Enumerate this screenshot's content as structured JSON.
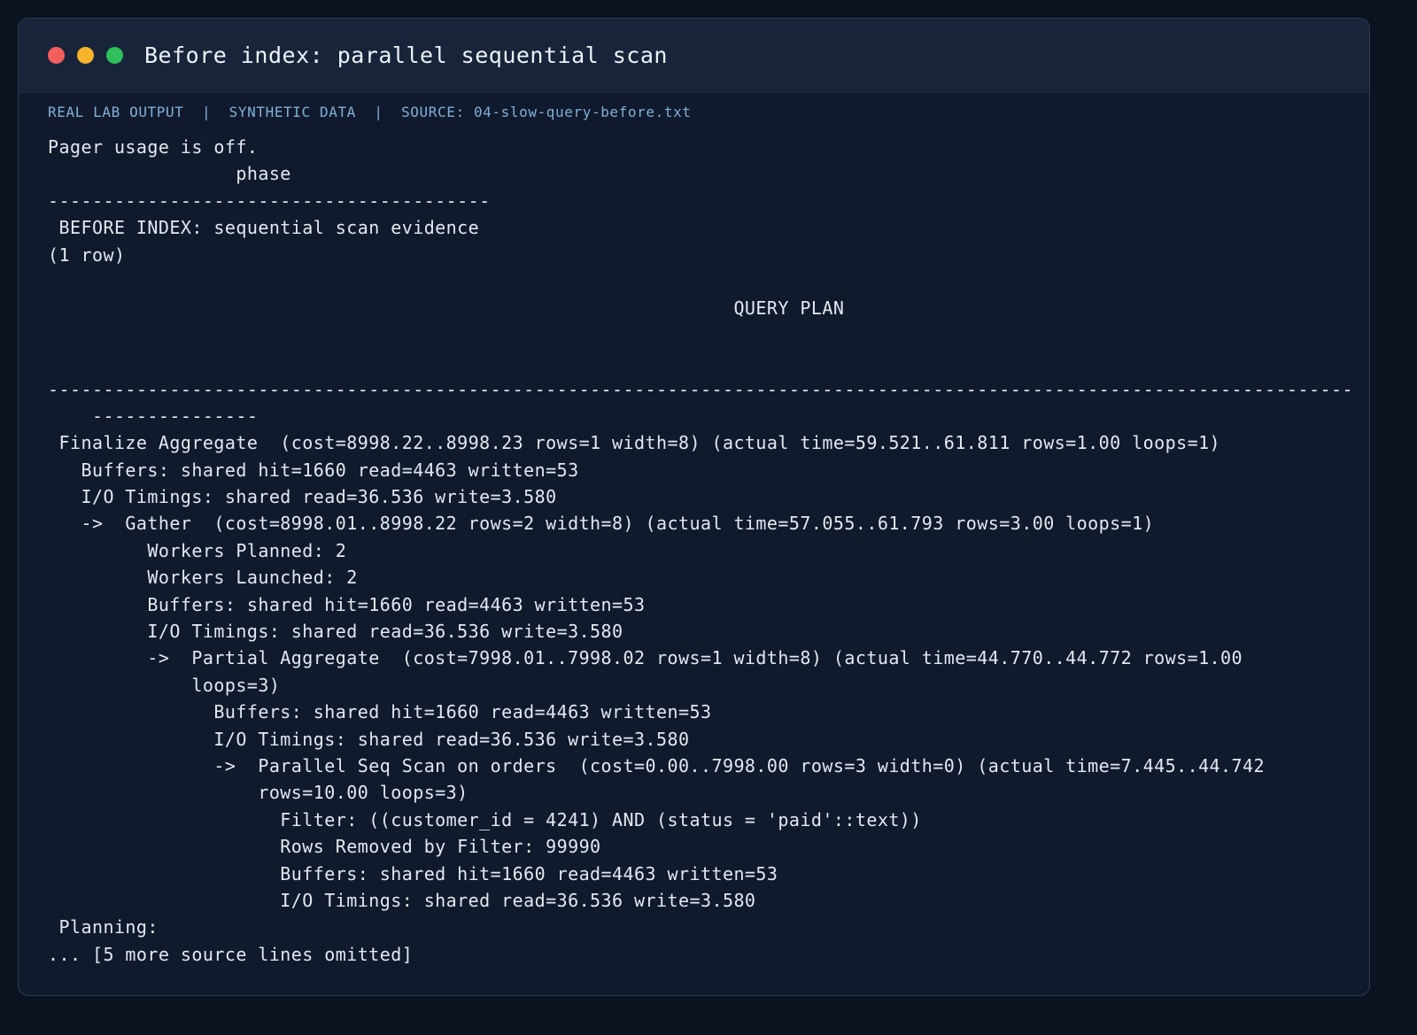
{
  "window": {
    "title": "Before index: parallel sequential scan",
    "buttons": {
      "close_color": "#f25f5c",
      "minimize_color": "#f7b32b",
      "maximize_color": "#2fbf5b"
    }
  },
  "meta": {
    "text": "REAL LAB OUTPUT  |  SYNTHETIC DATA  |  SOURCE: 04-slow-query-before.txt"
  },
  "output": {
    "lines": [
      "Pager usage is off.",
      "                 phase",
      "----------------------------------------",
      " BEFORE INDEX: sequential scan evidence",
      "(1 row)",
      "",
      "                                                              QUERY PLAN",
      "",
      "",
      "----------------------------------------------------------------------------------------------------------------------",
      "    ---------------",
      " Finalize Aggregate  (cost=8998.22..8998.23 rows=1 width=8) (actual time=59.521..61.811 rows=1.00 loops=1)",
      "   Buffers: shared hit=1660 read=4463 written=53",
      "   I/O Timings: shared read=36.536 write=3.580",
      "   ->  Gather  (cost=8998.01..8998.22 rows=2 width=8) (actual time=57.055..61.793 rows=3.00 loops=1)",
      "         Workers Planned: 2",
      "         Workers Launched: 2",
      "         Buffers: shared hit=1660 read=4463 written=53",
      "         I/O Timings: shared read=36.536 write=3.580",
      "         ->  Partial Aggregate  (cost=7998.01..7998.02 rows=1 width=8) (actual time=44.770..44.772 rows=1.00",
      "             loops=3)",
      "               Buffers: shared hit=1660 read=4463 written=53",
      "               I/O Timings: shared read=36.536 write=3.580",
      "               ->  Parallel Seq Scan on orders  (cost=0.00..7998.00 rows=3 width=0) (actual time=7.445..44.742",
      "                   rows=10.00 loops=3)",
      "                     Filter: ((customer_id = 4241) AND (status = 'paid'::text))",
      "                     Rows Removed by Filter: 99990",
      "                     Buffers: shared hit=1660 read=4463 written=53",
      "                     I/O Timings: shared read=36.536 write=3.580",
      " Planning:",
      "... [5 more source lines omitted]"
    ]
  }
}
